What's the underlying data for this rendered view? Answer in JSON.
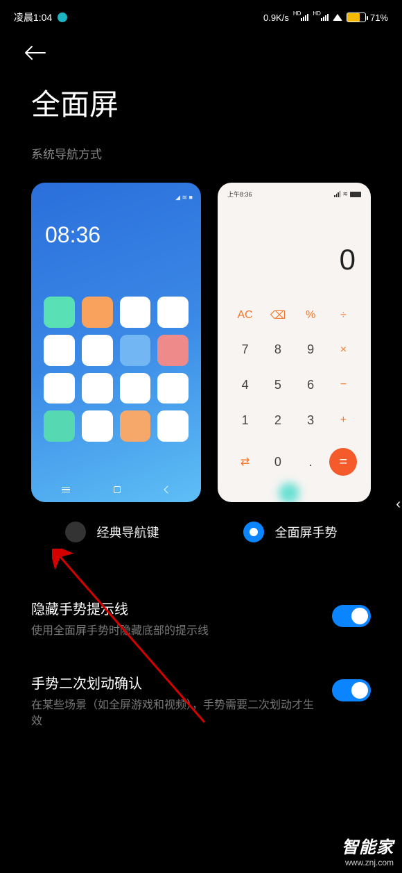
{
  "status_bar": {
    "time": "凌晨1:04",
    "speed": "0.9K/s",
    "signal_label": "HD",
    "battery_percent": "71%"
  },
  "title": "全面屏",
  "section_label": "系统导航方式",
  "previews": {
    "home": {
      "time": "08:36"
    },
    "calc": {
      "statusbar_time": "上午8:36",
      "display": "0",
      "keys": {
        "ac": "AC",
        "del": "⌫",
        "pct": "%",
        "div": "÷",
        "k7": "7",
        "k8": "8",
        "k9": "9",
        "mul": "×",
        "k4": "4",
        "k5": "5",
        "k6": "6",
        "sub": "−",
        "k1": "1",
        "k2": "2",
        "k3": "3",
        "add": "+",
        "swap": "⇄",
        "k0": "0",
        "dot": ".",
        "eq": "="
      }
    }
  },
  "options": {
    "classic": "经典导航键",
    "fullscreen": "全面屏手势"
  },
  "settings": {
    "hide_line": {
      "title": "隐藏手势提示线",
      "desc": "使用全面屏手势时隐藏底部的提示线"
    },
    "confirm": {
      "title": "手势二次划动确认",
      "desc": "在某些场景（如全屏游戏和视频），手势需要二次划动才生效"
    }
  },
  "watermark": {
    "brand": "智能家",
    "url": "www.znj.com"
  },
  "icon_colors": {
    "home_icons": [
      "#59e0b5",
      "#f8a25e",
      "#ffffff",
      "#ffffff",
      "#ffffff",
      "#ffffff",
      "#72b6f3",
      "#ef8a8a",
      "#ffffff",
      "#ffffff",
      "#ffffff",
      "#ffffff",
      "#56d8b3",
      "#ffffff",
      "#f5a86a",
      "#ffffff"
    ]
  }
}
